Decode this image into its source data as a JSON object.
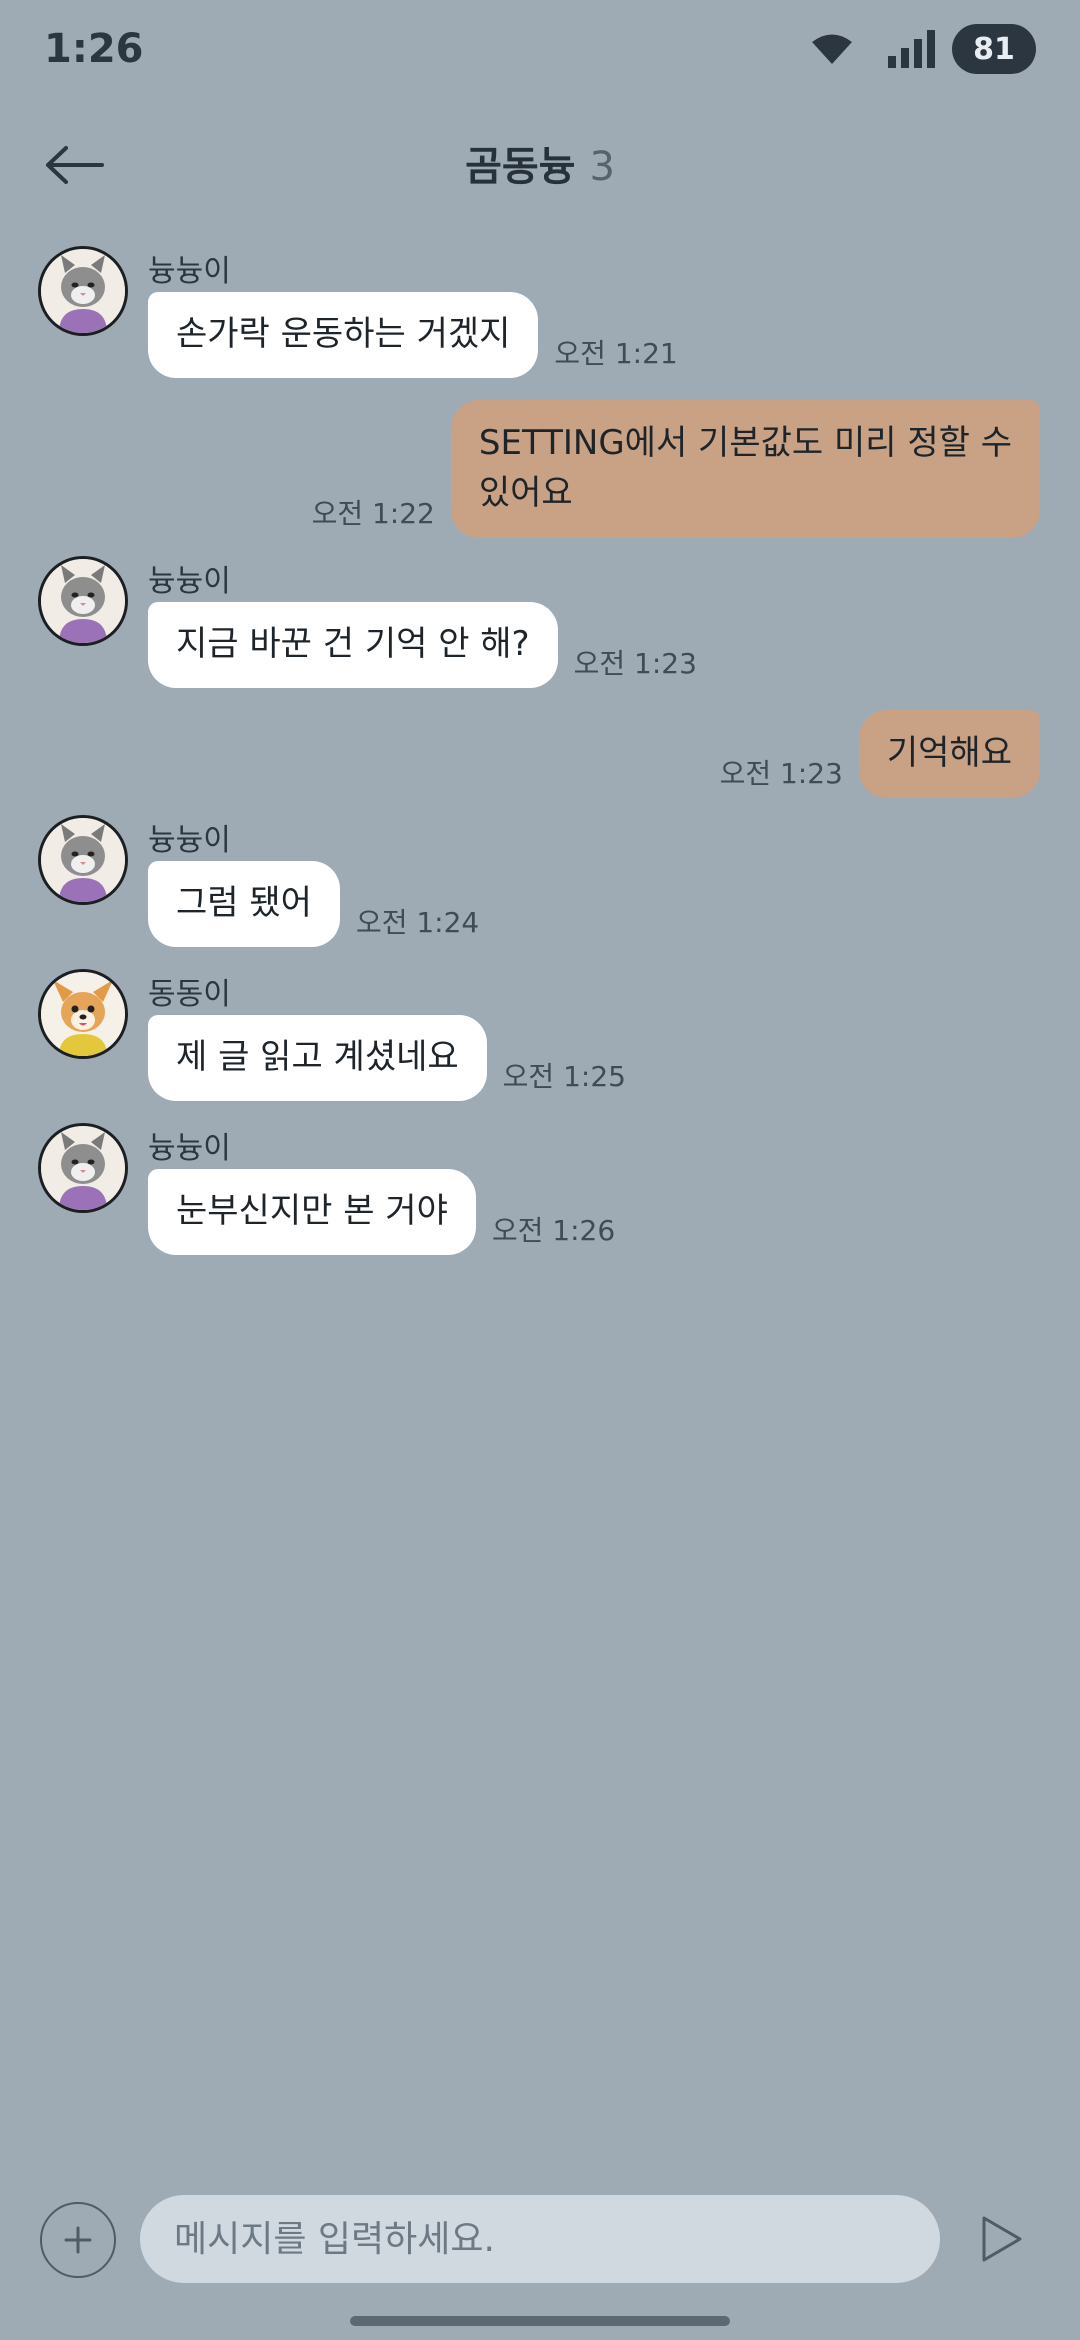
{
  "status_bar": {
    "time": "1:26",
    "battery": "81"
  },
  "header": {
    "title": "곰동늉",
    "member_count": "3"
  },
  "messages": [
    {
      "side": "left",
      "sender": "늉늉이",
      "avatar": "cat-avatar",
      "text": "손가락 운동하는 거겠지",
      "time": "오전 1:21"
    },
    {
      "side": "right",
      "text_line1": "SETTING에서 기본값도 미리 정할 수",
      "text_line2": "있어요",
      "time": "오전 1:22"
    },
    {
      "side": "left",
      "sender": "늉늉이",
      "avatar": "cat-avatar",
      "text": "지금 바꾼 건 기억 안 해?",
      "time": "오전 1:23"
    },
    {
      "side": "right",
      "text": "기억해요",
      "time": "오전 1:23"
    },
    {
      "side": "left",
      "sender": "늉늉이",
      "avatar": "cat-avatar",
      "text": "그럼 됐어",
      "time": "오전 1:24"
    },
    {
      "side": "left",
      "sender": "동동이",
      "avatar": "dog-avatar",
      "text": "제 글 읽고 계셨네요",
      "time": "오전 1:25"
    },
    {
      "side": "left",
      "sender": "늉늉이",
      "avatar": "cat-avatar",
      "text": "눈부신지만 본 거야",
      "time": "오전 1:26"
    }
  ],
  "input": {
    "placeholder": "메시지를 입력하세요."
  },
  "icons": {
    "back": "arrow-left-icon",
    "add": "plus-icon",
    "send": "send-icon",
    "wifi": "wifi-icon",
    "signal": "signal-icon"
  },
  "colors": {
    "background": "#9eabb5",
    "my_bubble": "#c9a184",
    "other_bubble": "#ffffff",
    "input_bg": "#d0d9df"
  }
}
